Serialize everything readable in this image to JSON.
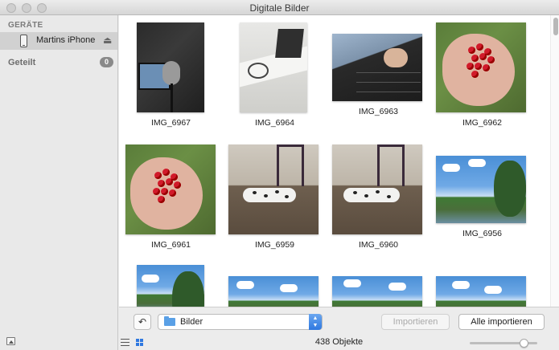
{
  "window": {
    "title": "Digitale Bilder"
  },
  "sidebar": {
    "section_devices": "GERÄTE",
    "device": {
      "name": "Martins iPhone",
      "icon": "iphone-icon",
      "eject_icon": "eject-icon"
    },
    "shared": {
      "label": "Geteilt",
      "count": "0"
    }
  },
  "photos": [
    {
      "name": "IMG_6967",
      "kind": "studio"
    },
    {
      "name": "IMG_6964",
      "kind": "desk"
    },
    {
      "name": "IMG_6963",
      "kind": "keys"
    },
    {
      "name": "IMG_6962",
      "kind": "berries"
    },
    {
      "name": "IMG_6961",
      "kind": "berries"
    },
    {
      "name": "IMG_6959",
      "kind": "dog"
    },
    {
      "name": "IMG_6960",
      "kind": "dog"
    },
    {
      "name": "IMG_6956",
      "kind": "sky"
    }
  ],
  "toolbar": {
    "rotate_icon": "rotate-left-icon",
    "destination": "Bilder",
    "destination_icon": "folder-icon",
    "import_label": "Importieren",
    "import_all_label": "Alle importieren"
  },
  "status": {
    "count_label": "438 Objekte",
    "zoom_level": 0.85
  }
}
